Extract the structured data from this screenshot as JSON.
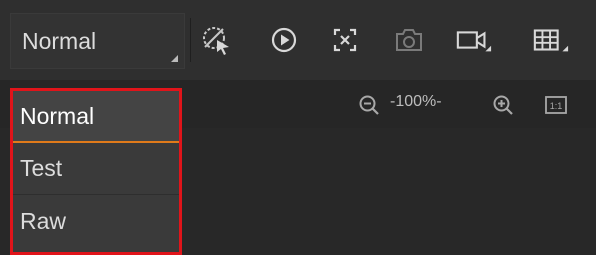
{
  "toolbar": {
    "mode_value": "Normal"
  },
  "toolbar_icons": [
    {
      "name": "roi-disabled-icon"
    },
    {
      "name": "play-icon"
    },
    {
      "name": "expand-icon"
    },
    {
      "name": "camera-icon"
    },
    {
      "name": "video-icon"
    },
    {
      "name": "grid-icon"
    }
  ],
  "zoom": {
    "label": "-100%-"
  },
  "fit": {
    "label": "1:1"
  },
  "mode_dropdown": {
    "options": [
      "Normal",
      "Test",
      "Raw"
    ],
    "selected": "Normal",
    "highlight_color": "#e0141a",
    "selected_underline_color": "#e07a1a"
  }
}
